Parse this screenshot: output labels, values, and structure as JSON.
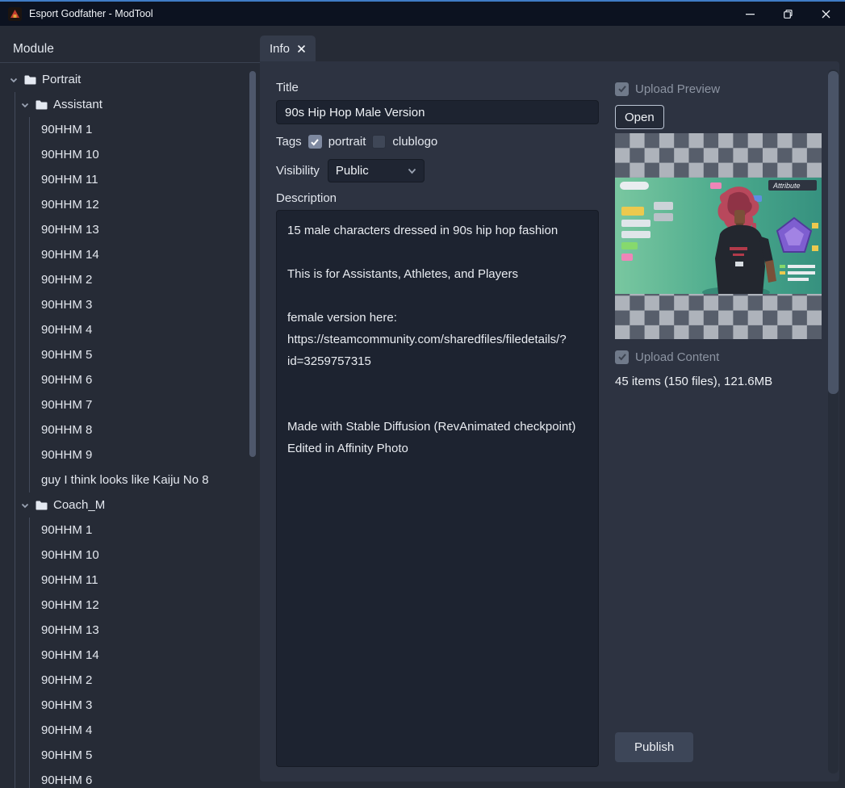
{
  "window": {
    "title": "Esport Godfather - ModTool"
  },
  "sidebar": {
    "header": "Module",
    "tree": [
      {
        "label": "Portrait",
        "kind": "folder",
        "expanded": true
      },
      {
        "label": "Assistant",
        "kind": "folder",
        "expanded": true
      },
      {
        "label": "90HHM 1"
      },
      {
        "label": "90HHM 10"
      },
      {
        "label": "90HHM 11"
      },
      {
        "label": "90HHM 12"
      },
      {
        "label": "90HHM 13"
      },
      {
        "label": "90HHM 14"
      },
      {
        "label": "90HHM 2"
      },
      {
        "label": "90HHM 3"
      },
      {
        "label": "90HHM 4"
      },
      {
        "label": "90HHM 5"
      },
      {
        "label": "90HHM 6"
      },
      {
        "label": "90HHM 7"
      },
      {
        "label": "90HHM 8"
      },
      {
        "label": "90HHM 9"
      },
      {
        "label": "guy I think looks like Kaiju No 8"
      },
      {
        "label": "Coach_M",
        "kind": "folder",
        "expanded": true
      },
      {
        "label": "90HHM 1"
      },
      {
        "label": "90HHM 10"
      },
      {
        "label": "90HHM 11"
      },
      {
        "label": "90HHM 12"
      },
      {
        "label": "90HHM 13"
      },
      {
        "label": "90HHM 14"
      },
      {
        "label": "90HHM 2"
      },
      {
        "label": "90HHM 3"
      },
      {
        "label": "90HHM 4"
      },
      {
        "label": "90HHM 5"
      },
      {
        "label": "90HHM 6"
      }
    ]
  },
  "tab": {
    "label": "Info"
  },
  "form": {
    "title_label": "Title",
    "title_value": "90s Hip Hop Male Version",
    "tags_label": "Tags",
    "tag_portrait": "portrait",
    "tag_portrait_checked": true,
    "tag_clublogo": "clublogo",
    "tag_clublogo_checked": false,
    "visibility_label": "Visibility",
    "visibility_value": "Public",
    "description_label": "Description",
    "description_value": "15 male characters dressed in 90s hip hop fashion\n\nThis is for Assistants, Athletes, and Players\n\nfemale version here:\nhttps://steamcommunity.com/sharedfiles/filedetails/?id=3259757315\n\n\nMade with Stable Diffusion (RevAnimated checkpoint)\nEdited in Affinity Photo"
  },
  "upload": {
    "preview_label": "Upload Preview",
    "preview_checked": true,
    "open_button": "Open",
    "preview_overlay_text": "Attribute",
    "content_label": "Upload Content",
    "content_checked": true,
    "stats": "45 items (150 files), 121.6MB",
    "publish_button": "Publish"
  },
  "colors": {
    "accent_border": "#3f7cc6",
    "titlebar": "#0c1220",
    "panel": "#2d3341",
    "input": "#1d2330",
    "checker_light": "#aeb3bb",
    "checker_dark": "#575e6b"
  }
}
